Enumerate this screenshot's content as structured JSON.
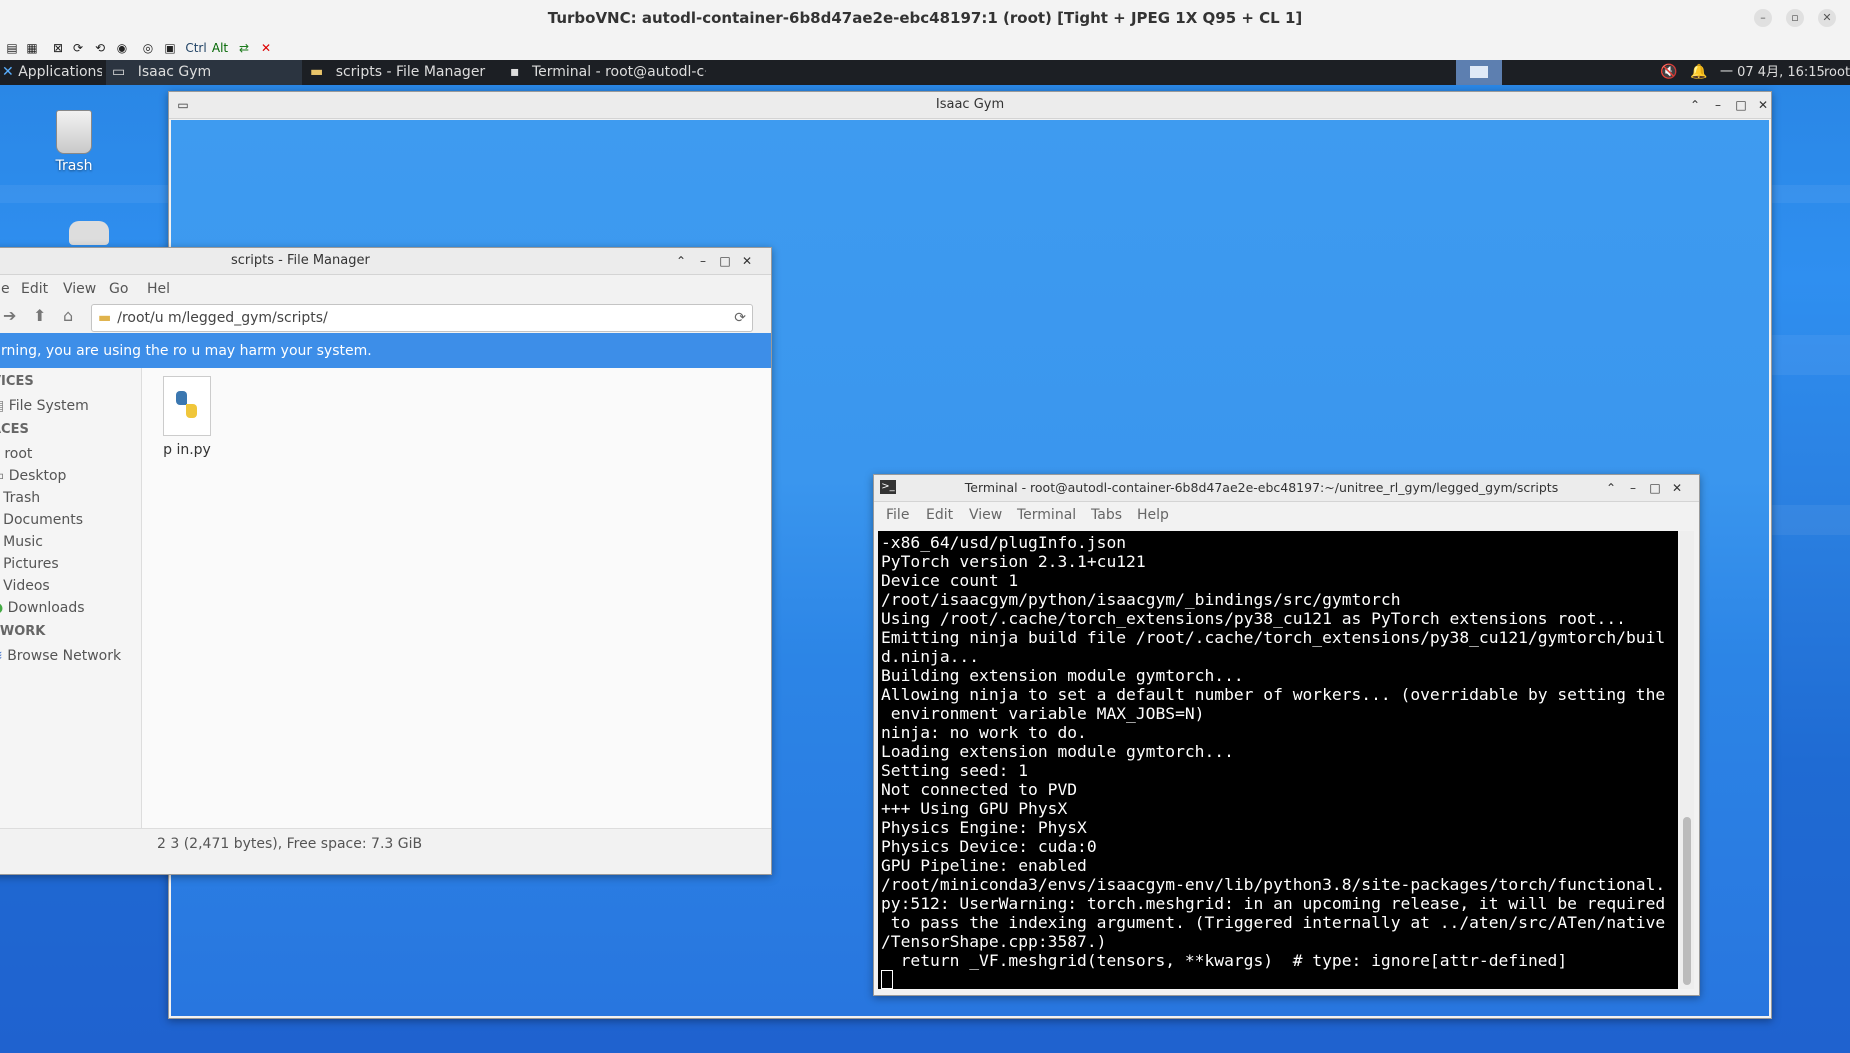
{
  "vnc": {
    "title": "TurboVNC: autodl-container-6b8d47ae2e-ebc48197:1 (root) [Tight + JPEG 1X Q95 + CL 1]",
    "toolbar_ctrl": "Ctrl",
    "toolbar_alt": "Alt"
  },
  "panel": {
    "applications": "Applications",
    "tasks": [
      "Isaac Gym",
      "scripts - File Manager",
      "Terminal - root@autodl-c···"
    ],
    "datetime": "一 07 4月, 16:15",
    "user": "root"
  },
  "desktop": {
    "trash_label": "Trash"
  },
  "isaac": {
    "title": "Isaac Gym"
  },
  "file_manager": {
    "title": "scripts - File Manager",
    "menu": [
      "e",
      "Edit",
      "View",
      "Go",
      "Hel"
    ],
    "path": "/root/u m/legged_gym/scripts/",
    "warning": "rning, you are using the ro  u may harm your system.",
    "sections": {
      "devices": "VICES",
      "places": "ACES",
      "network": "TWORK"
    },
    "device_items": [
      "File System"
    ],
    "place_items": [
      "root",
      "Desktop",
      "Trash",
      "Documents",
      "Music",
      "Pictures",
      "Videos",
      "Downloads"
    ],
    "network_items": [
      "Browse Network"
    ],
    "files": [
      {
        "name": "p in.py"
      }
    ],
    "status": "2 3 (2,471 bytes), Free space: 7.3 GiB"
  },
  "terminal": {
    "title": "Terminal - root@autodl-container-6b8d47ae2e-ebc48197:~/unitree_rl_gym/legged_gym/scripts",
    "menu": [
      "File",
      "Edit",
      "View",
      "Terminal",
      "Tabs",
      "Help"
    ],
    "lines": [
      "-x86_64/usd/plugInfo.json",
      "PyTorch version 2.3.1+cu121",
      "Device count 1",
      "/root/isaacgym/python/isaacgym/_bindings/src/gymtorch",
      "Using /root/.cache/torch_extensions/py38_cu121 as PyTorch extensions root...",
      "Emitting ninja build file /root/.cache/torch_extensions/py38_cu121/gymtorch/buil",
      "d.ninja...",
      "Building extension module gymtorch...",
      "Allowing ninja to set a default number of workers... (overridable by setting the",
      " environment variable MAX_JOBS=N)",
      "ninja: no work to do.",
      "Loading extension module gymtorch...",
      "Setting seed: 1",
      "Not connected to PVD",
      "+++ Using GPU PhysX",
      "Physics Engine: PhysX",
      "Physics Device: cuda:0",
      "GPU Pipeline: enabled",
      "/root/miniconda3/envs/isaacgym-env/lib/python3.8/site-packages/torch/functional.",
      "py:512: UserWarning: torch.meshgrid: in an upcoming release, it will be required",
      " to pass the indexing argument. (Triggered internally at ../aten/src/ATen/native",
      "/TensorShape.cpp:3587.)",
      "  return _VF.meshgrid(tensors, **kwargs)  # type: ignore[attr-defined]"
    ]
  }
}
